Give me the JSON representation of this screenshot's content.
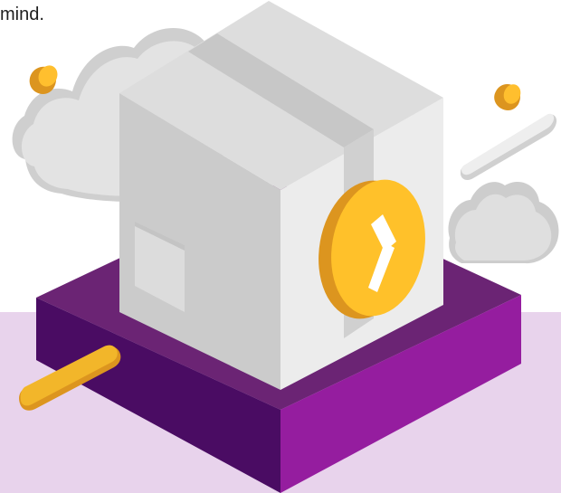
{
  "page": {
    "cropped_text": "mind."
  },
  "illustration": {
    "background_band_color": "#e8d3ec",
    "platform_top_color": "#6b2474",
    "platform_front_left_color": "#4a0c63",
    "platform_front_right_color": "#951d9f",
    "box_colors": {
      "top": "#dddddd",
      "left": "#cbcbcb",
      "right": "#ececec",
      "tape": "#bfbfbf"
    },
    "clock_colors": {
      "face": "#ffc12a",
      "rim": "#dc951f",
      "hands": "#ffffff"
    },
    "cloud_color": "#dfdfdf",
    "accent_gold": "#f2b62a",
    "icons": [
      "box-icon",
      "clock-icon",
      "cloud-icon",
      "platform-icon",
      "coin-icon",
      "pill-icon"
    ]
  }
}
